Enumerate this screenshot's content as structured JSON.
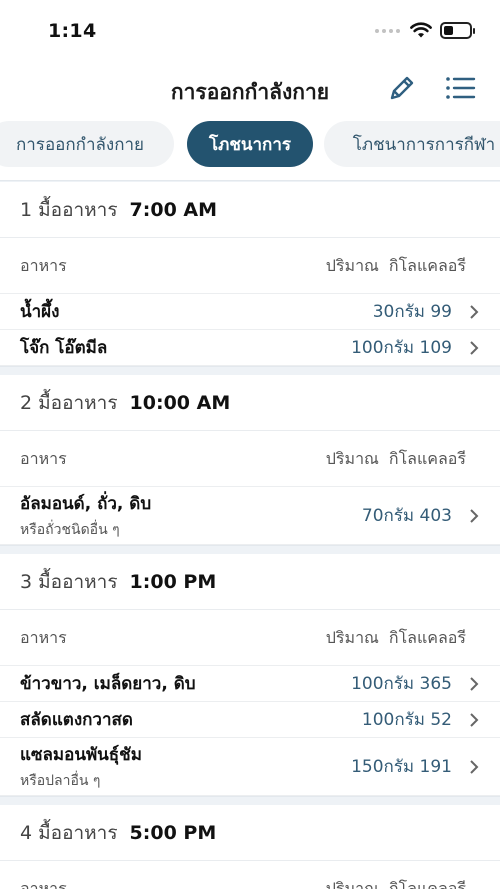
{
  "status": {
    "time": "1:14"
  },
  "nav": {
    "title": "การออกกำลังกาย",
    "edit_icon": "pencil-icon",
    "menu_icon": "list-icon"
  },
  "tabs": [
    {
      "label": "การออกกำลังกาย",
      "active": false
    },
    {
      "label": "โภชนาการ",
      "active": true
    },
    {
      "label": "โภชนาการการกีฬา",
      "active": false
    }
  ],
  "columns": {
    "food": "อาหาร",
    "amount": "ปริมาณ",
    "kcal": "กิโลแคลอรี"
  },
  "meals": [
    {
      "label": "1 มื้ออาหาร",
      "time": "7:00 AM",
      "items": [
        {
          "name": "น้ำผึ้ง",
          "sub": "",
          "qty": "30กรัม 99"
        },
        {
          "name": "โจ๊ก โอ๊ตมีล",
          "sub": "",
          "qty": "100กรัม 109"
        }
      ]
    },
    {
      "label": "2 มื้ออาหาร",
      "time": "10:00 AM",
      "items": [
        {
          "name": "อัลมอนด์, ถั่ว, ดิบ",
          "sub": "หรือถั่วชนิดอื่น ๆ",
          "qty": "70กรัม 403"
        }
      ]
    },
    {
      "label": "3 มื้ออาหาร",
      "time": "1:00 PM",
      "items": [
        {
          "name": "ข้าวขาว, เมล็ดยาว, ดิบ",
          "sub": "",
          "qty": "100กรัม 365"
        },
        {
          "name": "สลัดแตงกวาสด",
          "sub": "",
          "qty": "100กรัม 52"
        },
        {
          "name": "แซลมอนพันธุ์ชัม",
          "sub": "หรือปลาอื่น ๆ",
          "qty": "150กรัม 191"
        }
      ]
    },
    {
      "label": "4 มื้ออาหาร",
      "time": "5:00 PM",
      "items": []
    }
  ],
  "colors": {
    "accent": "#23536f",
    "qty_text": "#345c77",
    "band": "#eef2f6"
  }
}
